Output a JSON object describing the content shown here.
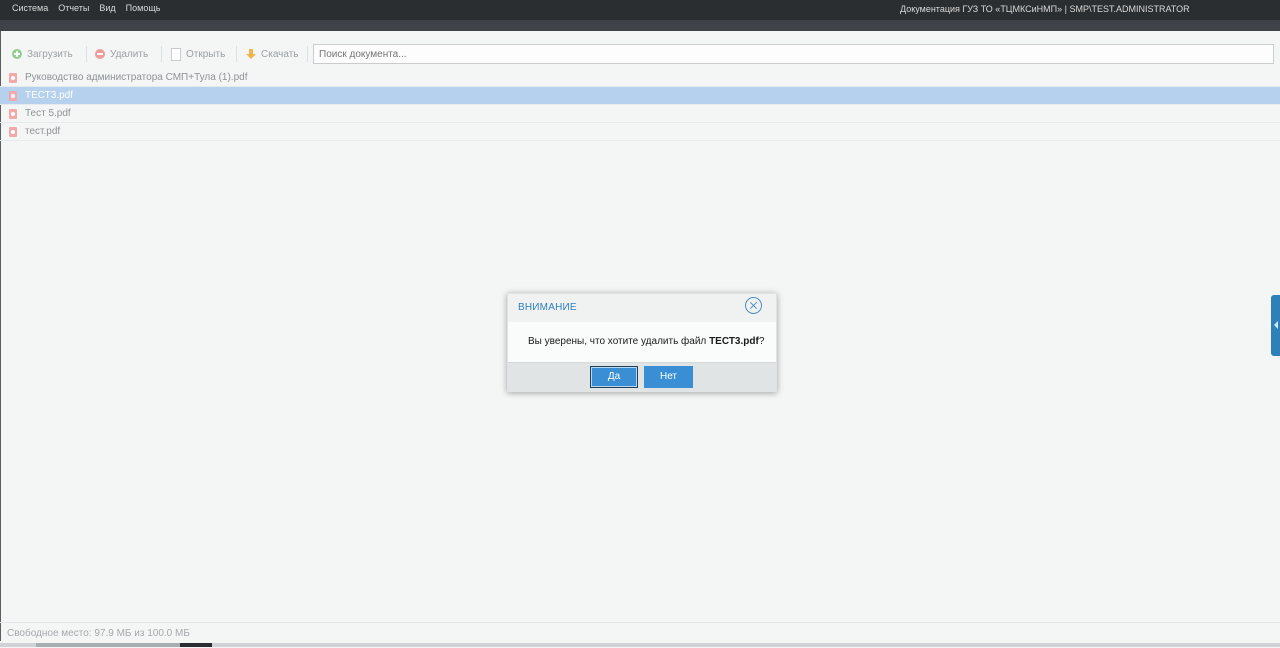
{
  "topbar": {
    "menu": [
      "Система",
      "Отчеты",
      "Вид",
      "Помощь"
    ],
    "app_title": "Документация ГУЗ ТО «ТЦМКСиНМП» | SMP\\TEST.ADMINISTRATOR"
  },
  "toolbar": {
    "upload_label": "Загрузить",
    "delete_label": "Удалить",
    "open_label": "Открыть",
    "download_label": "Скачать",
    "search_placeholder": "Поиск документа..."
  },
  "files": [
    {
      "name": "Руководство администратора СМП+Тула (1).pdf",
      "selected": false
    },
    {
      "name": "ТЕСТ3.pdf",
      "selected": true
    },
    {
      "name": "Тест 5.pdf",
      "selected": false
    },
    {
      "name": "тест.pdf",
      "selected": false
    }
  ],
  "status": {
    "free_space": "Свободное место: 97.9 МБ из 100.0 МБ"
  },
  "dialog": {
    "title": "ВНИМАНИЕ",
    "message_prefix": "Вы уверены, что хотите удалить файл ",
    "file_name": "ТЕСТ3.pdf",
    "message_suffix": "?",
    "yes_label": "Да",
    "no_label": "Нет"
  },
  "colors": {
    "selected_row": "#b5d1ee",
    "accent": "#3a8ed3",
    "topbar": "#2b2e31"
  }
}
